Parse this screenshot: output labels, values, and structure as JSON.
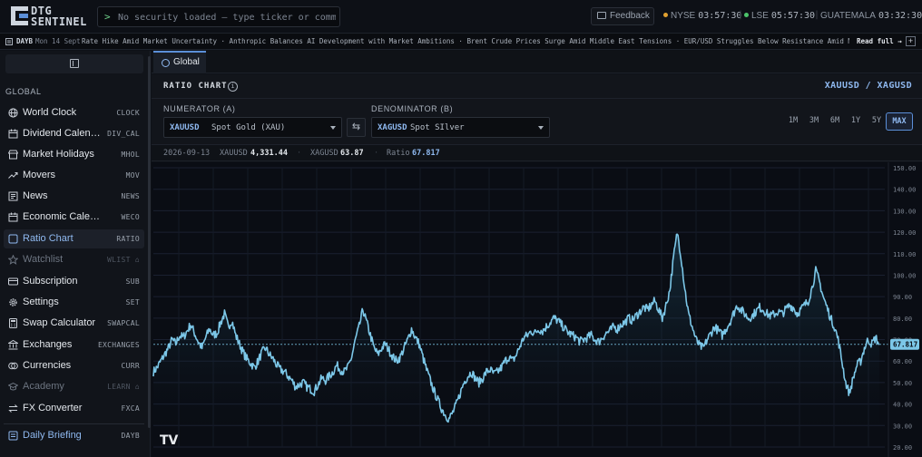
{
  "app": {
    "logo_line1": "DTG",
    "logo_line2": "SENTINEL"
  },
  "command_bar": {
    "prompt": ">",
    "placeholder": "No security loaded — type ticker or command"
  },
  "feedback_label": "Feedback",
  "clocks": [
    {
      "label": "NYSE",
      "time": "03:57:30",
      "dot_color": "#e0a030"
    },
    {
      "label": "LSE",
      "time": "05:57:30",
      "dot_color": "#4cc36a"
    },
    {
      "label": "GUATEMALA",
      "time": "03:32:30",
      "dot_color": ""
    }
  ],
  "news": {
    "tag": "DAYB",
    "date": "Mon 14 Sept",
    "ticker_text": "Rate Hike Amid Market Uncertainty · Anthropic Balances AI Development with Market Ambitions · Brent Crude Prices Surge Amid Middle East Tensions · EUR/USD Struggles Below Resistance Amid Market Uncert",
    "read_full": "Read full →",
    "plus": "+"
  },
  "sidebar": {
    "section": "GLOBAL",
    "items": [
      {
        "icon": "globe-icon",
        "label": "World Clock",
        "code": "CLOCK"
      },
      {
        "icon": "calendar-icon",
        "label": "Dividend Calendar",
        "code": "DIV_CAL"
      },
      {
        "icon": "store-icon",
        "label": "Market Holidays",
        "code": "MHOL"
      },
      {
        "icon": "trend-icon",
        "label": "Movers",
        "code": "MOV"
      },
      {
        "icon": "newspaper-icon",
        "label": "News",
        "code": "NEWS"
      },
      {
        "icon": "calendar-icon",
        "label": "Economic Calendar",
        "code": "WECO"
      },
      {
        "icon": "square-icon",
        "label": "Ratio Chart",
        "code": "RATIO"
      },
      {
        "icon": "star-icon",
        "label": "Watchlist",
        "code": "WLIST"
      },
      {
        "icon": "card-icon",
        "label": "Subscription",
        "code": "SUB"
      },
      {
        "icon": "gear-icon",
        "label": "Settings",
        "code": "SET"
      },
      {
        "icon": "calculator-icon",
        "label": "Swap Calculator",
        "code": "SWAPCAL"
      },
      {
        "icon": "bank-icon",
        "label": "Exchanges",
        "code": "EXCHANGES"
      },
      {
        "icon": "currency-icon",
        "label": "Currencies",
        "code": "CURR"
      },
      {
        "icon": "academy-icon",
        "label": "Academy",
        "code": "LEARN"
      },
      {
        "icon": "fx-icon",
        "label": "FX Converter",
        "code": "FXCA"
      },
      {
        "icon": "briefing-icon",
        "label": "Daily Briefing",
        "code": "DAYB"
      }
    ]
  },
  "tabs": [
    {
      "label": "Global"
    }
  ],
  "panel": {
    "title": "RATIO CHART",
    "info": "i",
    "pair": "XAUUSD / XAGUSD"
  },
  "numerator": {
    "label": "NUMERATOR (A)",
    "code": "XAUUSD",
    "name": "Spot Gold (XAU)"
  },
  "denominator": {
    "label": "DENOMINATOR (B)",
    "code": "XAGUSD",
    "name": "Spot SIlver"
  },
  "swap_glyph": "⇆",
  "ranges": [
    "1M",
    "3M",
    "6M",
    "1Y",
    "5Y",
    "MAX"
  ],
  "active_range": "MAX",
  "info_bar": {
    "date": "2026-09-13",
    "a_label": "XAUUSD",
    "a_value": "4,331.44",
    "b_label": "XAGUSD",
    "b_value": "63.87",
    "ratio_label": "Ratio",
    "ratio_value": "67.817"
  },
  "colors": {
    "accent": "#8fb9f0",
    "line": "#7cc7e8",
    "background": "#0a0d14"
  },
  "chart_data": {
    "type": "line",
    "y_axis_position": "right",
    "ylim": [
      20,
      150
    ],
    "y_ticks": [
      "150.00",
      "140.00",
      "130.00",
      "120.00",
      "110.00",
      "100.00",
      "90.00",
      "80.00",
      "70.00",
      "60.00",
      "50.00",
      "40.00",
      "30.00",
      "20.00"
    ],
    "current_value": 67.817,
    "current_label": "67.817",
    "watermark": "TV",
    "series": [
      {
        "values": [
          55,
          57,
          60,
          63,
          66,
          70,
          68,
          72,
          71,
          74,
          77,
          73,
          69,
          66,
          71,
          75,
          72,
          73,
          78,
          82,
          76,
          79,
          72,
          68,
          64,
          61,
          59,
          57,
          60,
          64,
          66,
          63,
          61,
          58,
          56,
          55,
          53,
          51,
          48,
          49,
          50,
          48,
          47,
          46,
          49,
          52,
          51,
          53,
          55,
          58,
          56,
          55,
          57,
          62,
          70,
          76,
          84,
          78,
          72,
          66,
          63,
          66,
          68,
          65,
          62,
          60,
          62,
          66,
          70,
          75,
          71,
          68,
          62,
          56,
          51,
          46,
          42,
          38,
          35,
          33,
          36,
          40,
          45,
          50,
          53,
          55,
          52,
          50,
          52,
          55,
          56,
          54,
          55,
          57,
          60,
          62,
          60,
          63,
          67,
          71,
          72,
          74,
          73,
          75,
          74,
          76,
          78,
          80,
          79,
          77,
          75,
          73,
          72,
          71,
          69,
          70,
          71,
          72,
          70,
          69,
          71,
          73,
          74,
          76,
          75,
          77,
          78,
          80,
          79,
          81,
          83,
          85,
          84,
          86,
          88,
          84,
          80,
          86,
          93,
          108,
          120,
          109,
          94,
          82,
          76,
          70,
          67,
          66,
          70,
          73,
          76,
          74,
          72,
          75,
          78,
          82,
          86,
          84,
          82,
          80,
          81,
          83,
          85,
          84,
          82,
          81,
          82,
          83,
          82,
          84,
          86,
          85,
          82,
          84,
          86,
          88,
          94,
          102,
          97,
          90,
          85,
          80,
          76,
          70,
          60,
          50,
          45,
          52,
          58,
          60,
          66,
          70,
          68,
          71,
          67.817
        ]
      }
    ]
  }
}
